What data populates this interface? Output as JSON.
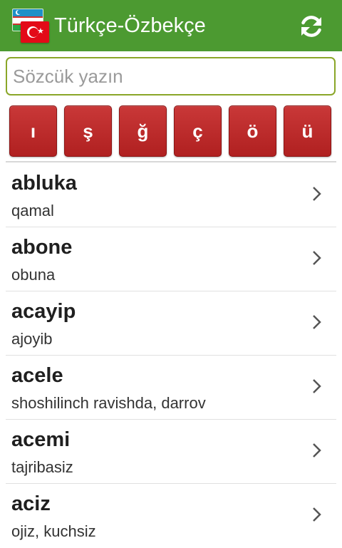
{
  "app": {
    "title": "Türkçe-Özbekçe"
  },
  "icons": {
    "flags": "uzbekistan-turkey-flags-icon",
    "refresh": "refresh-icon",
    "row_arrow": "chevron-right-icon"
  },
  "search": {
    "placeholder": "Sözcük yazın",
    "value": ""
  },
  "letter_keys": [
    "ı",
    "ş",
    "ğ",
    "ç",
    "ö",
    "ü"
  ],
  "entries": [
    {
      "word": "abluka",
      "meaning": "qamal"
    },
    {
      "word": "abone",
      "meaning": "obuna"
    },
    {
      "word": "acayip",
      "meaning": "ajoyib"
    },
    {
      "word": "acele",
      "meaning": "shoshilinch ravishda, darrov"
    },
    {
      "word": "acemi",
      "meaning": "tajribasiz"
    },
    {
      "word": "aciz",
      "meaning": "ojiz, kuchsiz"
    }
  ],
  "colors": {
    "appbar": "#4c9a31",
    "key": "#b82828",
    "search_border": "#8aa628"
  }
}
